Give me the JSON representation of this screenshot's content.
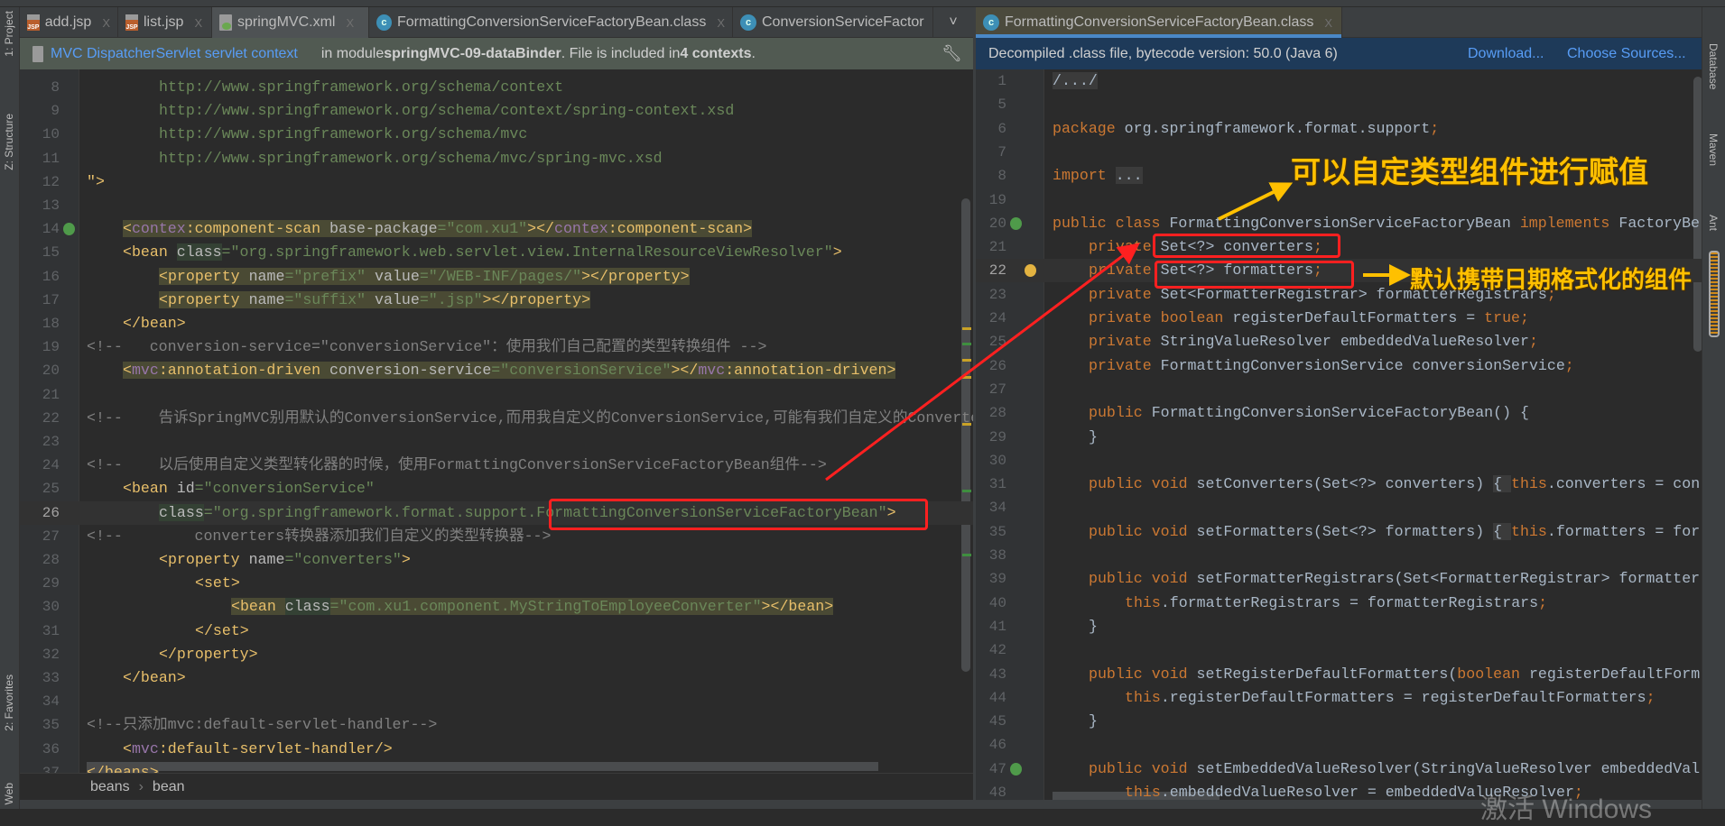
{
  "tabs_left": [
    {
      "label": "add.jsp",
      "icon": "jsp-file-icon",
      "active": false
    },
    {
      "label": "list.jsp",
      "icon": "jsp-file-icon",
      "active": false
    },
    {
      "label": "springMVC.xml",
      "icon": "xml-file-icon",
      "active": true
    },
    {
      "label": "FormattingConversionServiceFactoryBean.class",
      "icon": "class-file-icon",
      "active": false
    },
    {
      "label": "ConversionServiceFactor",
      "icon": "class-file-icon",
      "active": false
    }
  ],
  "tab_right": {
    "label": "FormattingConversionServiceFactoryBean.class",
    "icon": "class-file-icon",
    "active": true
  },
  "close_glyph": "X",
  "more_tabs_glyph": "˅",
  "info_left": {
    "link": "MVC DispatcherServlet servlet context",
    "pre": "in module ",
    "module": "springMVC-09-dataBinder",
    "mid": ". File is included in ",
    "count": "4 contexts",
    "end": "."
  },
  "info_right": {
    "text": "Decompiled .class file, bytecode version: 50.0 (Java 6)",
    "download": "Download...",
    "choose": "Choose Sources..."
  },
  "left_tools": [
    "1: Project",
    "Z: Structure",
    "2: Favorites",
    "Web"
  ],
  "right_tools": [
    "Database",
    "Maven",
    "Ant"
  ],
  "breadcrumb": [
    "beans",
    "bean"
  ],
  "breadcrumb_sep": "›",
  "annotations": {
    "note1": "可以自定类型组件进行赋值",
    "note2": "默认携带日期格式化的组件"
  },
  "watermark": "激活 Windows",
  "colors": {
    "arrow_red": "#ff2020",
    "note_yellow": "#ffc000",
    "accent_blue": "#4a88c7",
    "tag": "#e8bf6a",
    "string": "#6a8759",
    "keyword": "#cc7832"
  },
  "left_code": [
    {
      "n": "8",
      "i": 8,
      "tk": [
        [
          "v",
          "http://www.springframework.org/schema/context"
        ]
      ]
    },
    {
      "n": "9",
      "i": 8,
      "tk": [
        [
          "v",
          "http://www.springframework.org/schema/context/spring-context.xsd"
        ]
      ]
    },
    {
      "n": "10",
      "i": 8,
      "tk": [
        [
          "v",
          "http://www.springframework.org/schema/mvc"
        ]
      ]
    },
    {
      "n": "11",
      "i": 8,
      "tk": [
        [
          "v",
          "http://www.springframework.org/schema/mvc/spring-mvc.xsd"
        ]
      ]
    },
    {
      "n": "12",
      "i": 0,
      "tk": [
        [
          "t",
          "\">"
        ]
      ]
    },
    {
      "n": "13",
      "i": 0,
      "tk": []
    },
    {
      "n": "14",
      "i": 4,
      "hl": true,
      "icon": "spring-bean-icon",
      "tk": [
        [
          "t",
          "<"
        ],
        [
          "n",
          "contex"
        ],
        [
          "t",
          ":component-scan "
        ],
        [
          "a",
          "base-package"
        ],
        [
          "v",
          "=\"com.xu1\""
        ],
        [
          "t",
          "></"
        ],
        [
          "n",
          "contex"
        ],
        [
          "t",
          ":component-scan>"
        ]
      ]
    },
    {
      "n": "15",
      "i": 4,
      "tk": [
        [
          "t",
          "<bean "
        ],
        [
          "a h",
          "class"
        ],
        [
          "v",
          "=\"org.springframework.web.servlet.view.InternalResourceViewResolver\""
        ],
        [
          "t",
          ">"
        ]
      ]
    },
    {
      "n": "16",
      "i": 8,
      "hl": true,
      "tk": [
        [
          "t",
          "<property "
        ],
        [
          "a",
          "name"
        ],
        [
          "v",
          "=\"prefix\" "
        ],
        [
          "a",
          "value"
        ],
        [
          "v",
          "=\"/WEB-INF/pages/\""
        ],
        [
          "t",
          "></property>"
        ]
      ]
    },
    {
      "n": "17",
      "i": 8,
      "hl": true,
      "tk": [
        [
          "t",
          "<property "
        ],
        [
          "a",
          "name"
        ],
        [
          "v",
          "=\"suffix\" "
        ],
        [
          "a",
          "value"
        ],
        [
          "v",
          "=\".jsp\""
        ],
        [
          "t",
          "></property>"
        ]
      ]
    },
    {
      "n": "18",
      "i": 4,
      "tk": [
        [
          "t",
          "</bean>"
        ]
      ]
    },
    {
      "n": "19",
      "i": 0,
      "tk": [
        [
          "c",
          "<!--   conversion-service=\"conversionService\"：使用我们自己配置的类型转换组件 -->"
        ]
      ]
    },
    {
      "n": "20",
      "i": 4,
      "hl": true,
      "tk": [
        [
          "t",
          "<"
        ],
        [
          "n",
          "mvc"
        ],
        [
          "t",
          ":annotation-driven "
        ],
        [
          "a",
          "conversion-service"
        ],
        [
          "v",
          "=\"conversionService\""
        ],
        [
          "t",
          "></"
        ],
        [
          "n",
          "mvc"
        ],
        [
          "t",
          ":annotation-driven>"
        ]
      ]
    },
    {
      "n": "21",
      "i": 0,
      "tk": []
    },
    {
      "n": "22",
      "i": 0,
      "tk": [
        [
          "c",
          "<!--    告诉SpringMVC别用默认的ConversionService,而用我自定义的ConversionService,可能有我们自定义的Converter"
        ]
      ]
    },
    {
      "n": "23",
      "i": 0,
      "tk": []
    },
    {
      "n": "24",
      "i": 0,
      "tk": [
        [
          "c",
          "<!--    以后使用自定义类型转化器的时候，使用FormattingConversionServiceFactoryBean组件-->"
        ]
      ]
    },
    {
      "n": "25",
      "i": 4,
      "tk": [
        [
          "t",
          "<bean "
        ],
        [
          "a",
          "id"
        ],
        [
          "v",
          "=\"conversionService\""
        ]
      ]
    },
    {
      "n": "26",
      "i": 8,
      "caret": true,
      "tk": [
        [
          "a h",
          "class"
        ],
        [
          "v",
          "=\"org.springframework.format.support.FormattingConversionServiceFactoryBean\""
        ],
        [
          "t",
          ">"
        ]
      ]
    },
    {
      "n": "27",
      "i": 0,
      "tk": [
        [
          "c",
          "<!--        converters转换器添加我们自定义的类型转换器-->"
        ]
      ]
    },
    {
      "n": "28",
      "i": 8,
      "tk": [
        [
          "t",
          "<property "
        ],
        [
          "a",
          "name"
        ],
        [
          "v",
          "=\"converters\""
        ],
        [
          "t",
          ">"
        ]
      ]
    },
    {
      "n": "29",
      "i": 12,
      "tk": [
        [
          "t",
          "<set>"
        ]
      ]
    },
    {
      "n": "30",
      "i": 16,
      "hl": true,
      "tk": [
        [
          "t",
          "<bean "
        ],
        [
          "a h",
          "class"
        ],
        [
          "v",
          "=\"com.xu1.component.MyStringToEmployeeConverter\""
        ],
        [
          "t",
          "></bean>"
        ]
      ]
    },
    {
      "n": "31",
      "i": 12,
      "tk": [
        [
          "t",
          "</set>"
        ]
      ]
    },
    {
      "n": "32",
      "i": 8,
      "tk": [
        [
          "t",
          "</property>"
        ]
      ]
    },
    {
      "n": "33",
      "i": 4,
      "tk": [
        [
          "t",
          "</bean>"
        ]
      ]
    },
    {
      "n": "34",
      "i": 0,
      "tk": []
    },
    {
      "n": "35",
      "i": 0,
      "tk": [
        [
          "c",
          "<!--只添加mvc:default-servlet-handler-->"
        ]
      ]
    },
    {
      "n": "36",
      "i": 4,
      "tk": [
        [
          "t",
          "<"
        ],
        [
          "n",
          "mvc"
        ],
        [
          "t",
          ":default-servlet-handler/>"
        ]
      ]
    },
    {
      "n": "37",
      "i": 0,
      "tk": [
        [
          "t sel",
          "</beans>"
        ]
      ]
    }
  ],
  "right_code": [
    {
      "n": "1",
      "i": 0,
      "tk": [
        [
          "p f",
          "/.../"
        ]
      ]
    },
    {
      "n": "5",
      "i": 0,
      "tk": []
    },
    {
      "n": "6",
      "i": 0,
      "tk": [
        [
          "k",
          "package "
        ],
        [
          "p",
          "org.springframework.format.support"
        ],
        [
          "k",
          ";"
        ]
      ]
    },
    {
      "n": "7",
      "i": 0,
      "tk": []
    },
    {
      "n": "8",
      "i": 0,
      "tk": [
        [
          "k",
          "import "
        ],
        [
          "p f",
          "..."
        ]
      ]
    },
    {
      "n": "19",
      "i": 0,
      "tk": []
    },
    {
      "n": "20",
      "i": 0,
      "icon": "bean-class-icon",
      "tk": [
        [
          "k",
          "public class "
        ],
        [
          "p",
          "FormattingConversionServiceFactoryBean "
        ],
        [
          "k",
          "implements "
        ],
        [
          "p",
          "FactoryBe"
        ]
      ]
    },
    {
      "n": "21",
      "i": 4,
      "tk": [
        [
          "k",
          "private "
        ],
        [
          "p",
          "Set<?> converters"
        ],
        [
          "k",
          ";"
        ]
      ]
    },
    {
      "n": "22",
      "i": 4,
      "caret": true,
      "icon": "lightbulb-icon",
      "tk": [
        [
          "k",
          "private "
        ],
        [
          "p",
          "Set<?> formatters"
        ],
        [
          "k",
          ";"
        ]
      ]
    },
    {
      "n": "23",
      "i": 4,
      "tk": [
        [
          "k",
          "private "
        ],
        [
          "p",
          "Set<FormatterRegistrar> formatterRegistrars"
        ],
        [
          "k",
          ";"
        ]
      ]
    },
    {
      "n": "24",
      "i": 4,
      "tk": [
        [
          "k",
          "private boolean "
        ],
        [
          "p",
          "registerDefaultFormatters = "
        ],
        [
          "k",
          "true;"
        ]
      ]
    },
    {
      "n": "25",
      "i": 4,
      "tk": [
        [
          "k",
          "private "
        ],
        [
          "p",
          "StringValueResolver embeddedValueResolver"
        ],
        [
          "k",
          ";"
        ]
      ]
    },
    {
      "n": "26",
      "i": 4,
      "tk": [
        [
          "k",
          "private "
        ],
        [
          "p",
          "FormattingConversionService conversionService"
        ],
        [
          "k",
          ";"
        ]
      ]
    },
    {
      "n": "27",
      "i": 0,
      "tk": []
    },
    {
      "n": "28",
      "i": 4,
      "tk": [
        [
          "k",
          "public "
        ],
        [
          "p",
          "FormattingConversionServiceFactoryBean() {"
        ]
      ]
    },
    {
      "n": "29",
      "i": 4,
      "tk": [
        [
          "p",
          "}"
        ]
      ]
    },
    {
      "n": "30",
      "i": 0,
      "tk": []
    },
    {
      "n": "31",
      "i": 4,
      "tk": [
        [
          "k",
          "public void "
        ],
        [
          "p",
          "setConverters(Set<?> converters) "
        ],
        [
          "p f",
          "{ "
        ],
        [
          "k",
          "this"
        ],
        [
          "p",
          ".converters = con"
        ]
      ]
    },
    {
      "n": "34",
      "i": 0,
      "tk": []
    },
    {
      "n": "35",
      "i": 4,
      "tk": [
        [
          "k",
          "public void "
        ],
        [
          "p",
          "setFormatters(Set<?> formatters) "
        ],
        [
          "p f",
          "{ "
        ],
        [
          "k",
          "this"
        ],
        [
          "p",
          ".formatters = for"
        ]
      ]
    },
    {
      "n": "38",
      "i": 0,
      "tk": []
    },
    {
      "n": "39",
      "i": 4,
      "tk": [
        [
          "k",
          "public void "
        ],
        [
          "p",
          "setFormatterRegistrars(Set<FormatterRegistrar> formatter"
        ]
      ]
    },
    {
      "n": "40",
      "i": 8,
      "tk": [
        [
          "k",
          "this"
        ],
        [
          "p",
          ".formatterRegistrars = formatterRegistrars"
        ],
        [
          "k",
          ";"
        ]
      ]
    },
    {
      "n": "41",
      "i": 4,
      "tk": [
        [
          "p",
          "}"
        ]
      ]
    },
    {
      "n": "42",
      "i": 0,
      "tk": []
    },
    {
      "n": "43",
      "i": 4,
      "tk": [
        [
          "k",
          "public void "
        ],
        [
          "p",
          "setRegisterDefaultFormatters("
        ],
        [
          "k",
          "boolean "
        ],
        [
          "p",
          "registerDefaultForm"
        ]
      ]
    },
    {
      "n": "44",
      "i": 8,
      "tk": [
        [
          "k",
          "this"
        ],
        [
          "p",
          ".registerDefaultFormatters = registerDefaultFormatters"
        ],
        [
          "k",
          ";"
        ]
      ]
    },
    {
      "n": "45",
      "i": 4,
      "tk": [
        [
          "p",
          "}"
        ]
      ]
    },
    {
      "n": "46",
      "i": 0,
      "tk": []
    },
    {
      "n": "47",
      "i": 4,
      "icon": "override-icon",
      "tk": [
        [
          "k",
          "public void "
        ],
        [
          "p",
          "setEmbeddedValueResolver(StringValueResolver embeddedVal"
        ]
      ]
    },
    {
      "n": "48",
      "i": 8,
      "tk": [
        [
          "k",
          "this"
        ],
        [
          "p",
          ".embeddedValueResolver = embeddedValueResolver"
        ],
        [
          "k",
          ";"
        ]
      ]
    }
  ]
}
